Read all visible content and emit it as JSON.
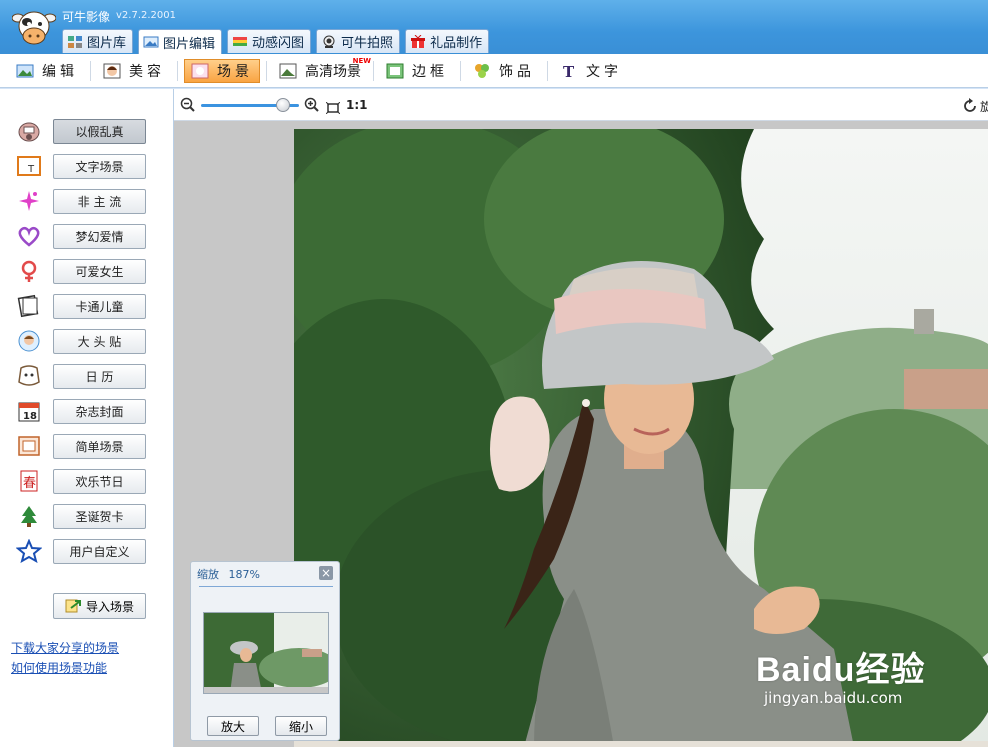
{
  "app": {
    "title": "可牛影像",
    "version": "v2.7.2.2001"
  },
  "main_tabs": [
    {
      "label": "图片库",
      "icon": "gallery-icon"
    },
    {
      "label": "图片编辑",
      "icon": "edit-photo-icon",
      "active": true
    },
    {
      "label": "动感闪图",
      "icon": "flash-image-icon"
    },
    {
      "label": "可牛拍照",
      "icon": "webcam-icon"
    },
    {
      "label": "礼品制作",
      "icon": "gift-icon"
    }
  ],
  "sub_tools": [
    {
      "label": "编辑",
      "icon": "edit-icon"
    },
    {
      "label": "美容",
      "icon": "beauty-icon"
    },
    {
      "label": "场景",
      "icon": "scene-icon",
      "active": true
    },
    {
      "label": "高清场景",
      "icon": "hd-scene-icon",
      "badge": "NEW"
    },
    {
      "label": "边框",
      "icon": "frame-icon"
    },
    {
      "label": "饰品",
      "icon": "accessory-icon"
    },
    {
      "label": "文字",
      "icon": "text-icon"
    }
  ],
  "scene_categories": [
    {
      "label": "以假乱真",
      "icon": "cow-face-icon",
      "active": true
    },
    {
      "label": "文字场景",
      "icon": "text-scene-icon"
    },
    {
      "label": "非 主 流",
      "icon": "sparkle-icon"
    },
    {
      "label": "梦幻爱情",
      "icon": "heart-icon"
    },
    {
      "label": "可爱女生",
      "icon": "female-icon"
    },
    {
      "label": "卡通儿童",
      "icon": "cartoon-book-icon"
    },
    {
      "label": "大 头 贴",
      "icon": "photo-sticker-icon"
    },
    {
      "label": "日  历",
      "icon": "calendar-dog-icon"
    },
    {
      "label": "杂志封面",
      "icon": "calendar-18-icon"
    },
    {
      "label": "简单场景",
      "icon": "simple-frame-icon"
    },
    {
      "label": "欢乐节日",
      "icon": "spring-festival-icon"
    },
    {
      "label": "圣诞贺卡",
      "icon": "christmas-tree-icon"
    },
    {
      "label": "用户自定义",
      "icon": "star-outline-icon"
    }
  ],
  "import_scene_label": "导入场景",
  "links": {
    "download_shared": "下载大家分享的场景",
    "how_to_use": "如何使用场景功能"
  },
  "zoombar": {
    "ratio_label": "1:1",
    "rotate_label": "旋"
  },
  "zoom_panel": {
    "title": "缩放",
    "percent": "187%",
    "zoom_in_label": "放大",
    "zoom_out_label": "缩小"
  },
  "watermark": {
    "main": "Baidu经验",
    "sub": "jingyan.baidu.com"
  },
  "colors": {
    "header_blue": "#3c95dc",
    "active_orange": "#f9a443",
    "link_blue": "#1a4fb4"
  }
}
